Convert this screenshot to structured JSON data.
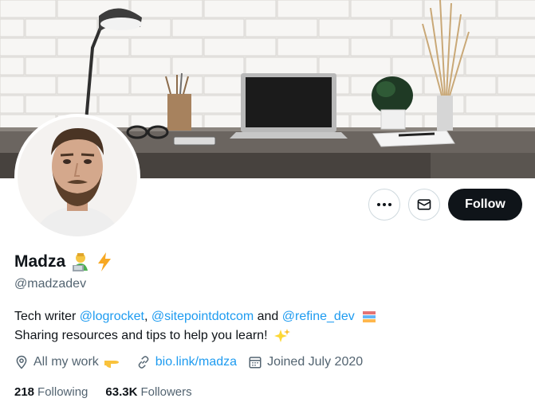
{
  "profile": {
    "display_name": "Madza",
    "handle": "@madzadev",
    "bio": {
      "line1_prefix": "Tech writer ",
      "mention1": "@logrocket",
      "sep1": ", ",
      "mention2": "@sitepointdotcom",
      "sep2": " and ",
      "mention3": "@refine_dev",
      "line2": "Sharing resources and tips to help you learn!"
    },
    "location": "All my work",
    "website": "bio.link/madza",
    "joined": "Joined July 2020",
    "following_count": "218",
    "following_label": "Following",
    "followers_count": "63.3K",
    "followers_label": "Followers"
  },
  "actions": {
    "follow_label": "Follow",
    "more_icon": "more-horizontal-icon",
    "message_icon": "envelope-icon"
  },
  "icons": {
    "location": "location-pin-icon",
    "link": "link-icon",
    "calendar": "calendar-icon"
  },
  "colors": {
    "link": "#1d9bf0",
    "follow_bg": "#0f1419",
    "secondary_text": "#536471"
  }
}
